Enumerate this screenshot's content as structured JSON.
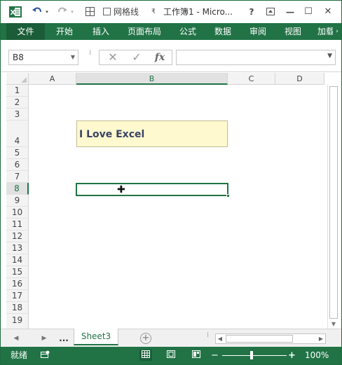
{
  "titlebar": {
    "undo_icon": "undo-icon",
    "redo_icon": "redo-icon",
    "gridlines_label": "网格线",
    "title": "工作簿1 - Micro...",
    "help": "?",
    "minimize": "—",
    "maximize": "☐",
    "close": "✕"
  },
  "ribbon": {
    "tabs": [
      "文件",
      "开始",
      "插入",
      "页面布局",
      "公式",
      "数据",
      "审阅",
      "视图",
      "加载"
    ]
  },
  "formula_bar": {
    "name_box": "B8",
    "cancel": "✕",
    "enter": "✓",
    "fx": "fx",
    "formula": ""
  },
  "grid": {
    "columns": [
      "A",
      "B",
      "C",
      "D"
    ],
    "selected_column": "B",
    "rows": [
      "1",
      "2",
      "3",
      "4",
      "5",
      "6",
      "7",
      "8",
      "9",
      "10",
      "11",
      "12",
      "13",
      "14",
      "15",
      "16",
      "17",
      "18",
      "19"
    ],
    "selected_row": "8",
    "cell_b4_text": "I Love Excel",
    "cell_b4_fill": "#fff9cf",
    "selected_cell": "B8",
    "cursor": "✚"
  },
  "sheet_tabs": {
    "prev": "◀",
    "next": "▶",
    "more": "...",
    "active": "Sheet3",
    "add": "+"
  },
  "status_bar": {
    "mode": "就绪",
    "zoom_minus": "−",
    "zoom_plus": "+",
    "zoom": "100%"
  },
  "colors": {
    "accent": "#217346",
    "accent_dark": "#1a5d38"
  }
}
